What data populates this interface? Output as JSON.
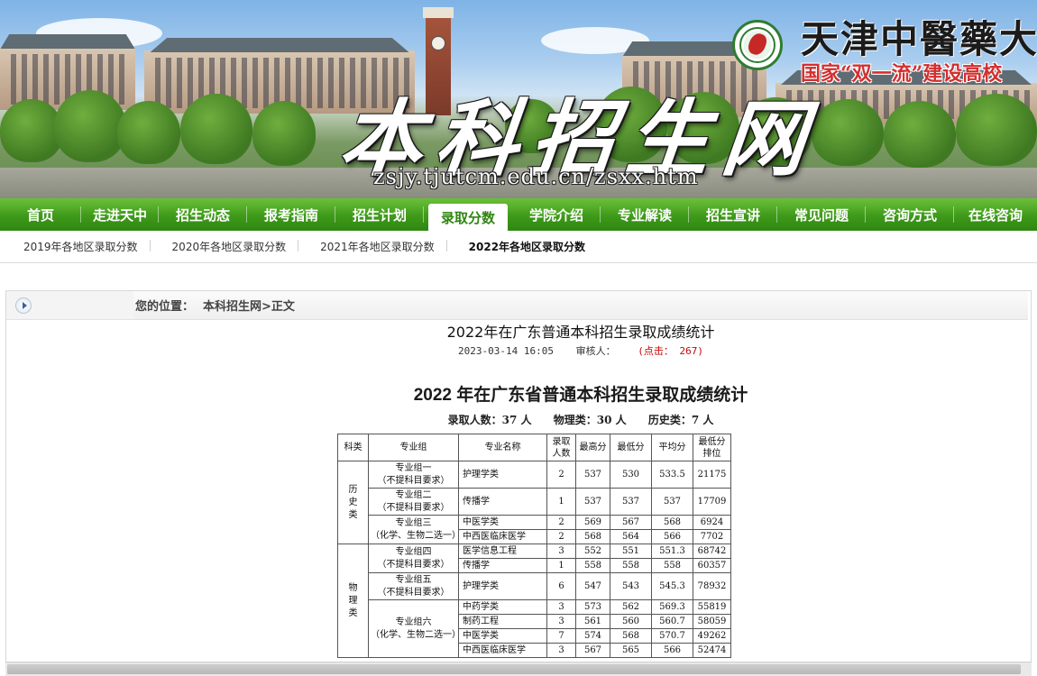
{
  "banner": {
    "site_title": "本科招生网",
    "url": "zsjy.tjutcm.edu.cn/zsxx.htm",
    "university_name": "天津中醫藥大學",
    "slogan": "国家“双一流”建设高校"
  },
  "main_nav": {
    "items": [
      {
        "label": "首页"
      },
      {
        "label": "走进天中"
      },
      {
        "label": "招生动态"
      },
      {
        "label": "报考指南"
      },
      {
        "label": "招生计划"
      },
      {
        "label": "录取分数",
        "active": true
      },
      {
        "label": "学院介绍"
      },
      {
        "label": "专业解读"
      },
      {
        "label": "招生宣讲"
      },
      {
        "label": "常见问题"
      },
      {
        "label": "咨询方式"
      },
      {
        "label": "在线咨询"
      }
    ]
  },
  "sub_nav": {
    "items": [
      {
        "label": "2019年各地区录取分数"
      },
      {
        "label": "2020年各地区录取分数"
      },
      {
        "label": "2021年各地区录取分数"
      },
      {
        "label": "2022年各地区录取分数",
        "current": true
      }
    ]
  },
  "location": {
    "label": "您的位置：",
    "crumbs": "本科招生网>正文"
  },
  "article": {
    "title": "2022年在广东普通本科招生录取成绩统计",
    "date": "2023-03-14 16:05",
    "reviewer": "审核人：",
    "hits": "(点击： 267)"
  },
  "document": {
    "title": "2022 年在广东省普通本科招生录取成绩统计",
    "total": "录取人数：37 人",
    "physics": "物理类：30 人",
    "history": "历史类：7 人",
    "table": {
      "headers": [
        "科类",
        "专业组",
        "专业名称",
        "录取人数",
        "最高分",
        "最低分",
        "平均分",
        "最低分排位"
      ],
      "header_lines": {
        "admitted": [
          "录取",
          "人数"
        ],
        "min_rank": [
          "最低分",
          "排位"
        ]
      },
      "categories": [
        {
          "name": "历史类",
          "chars": [
            "历",
            "史",
            "类"
          ]
        },
        {
          "name": "物理类",
          "chars": [
            "物",
            "理",
            "类"
          ]
        }
      ],
      "groups": [
        {
          "line1": "专业组一",
          "line2": "（不提科目要求）"
        },
        {
          "line1": "专业组二",
          "line2": "（不提科目要求）"
        },
        {
          "line1": "专业组三",
          "line2": "（化学、生物二选一）"
        },
        {
          "line1": "专业组四",
          "line2": "（不提科目要求）"
        },
        {
          "line1": "专业组五",
          "line2": "（不提科目要求）"
        },
        {
          "line1": "专业组六",
          "line2": "（化学、生物二选一）"
        }
      ],
      "rows": [
        {
          "major": "护理学类",
          "count": "2",
          "max": "537",
          "min": "530",
          "avg": "533.5",
          "rank": "21175"
        },
        {
          "major": "传播学",
          "count": "1",
          "max": "537",
          "min": "537",
          "avg": "537",
          "rank": "17709"
        },
        {
          "major": "中医学类",
          "count": "2",
          "max": "569",
          "min": "567",
          "avg": "568",
          "rank": "6924"
        },
        {
          "major": "中西医临床医学",
          "count": "2",
          "max": "568",
          "min": "564",
          "avg": "566",
          "rank": "7702"
        },
        {
          "major": "医学信息工程",
          "count": "3",
          "max": "552",
          "min": "551",
          "avg": "551.3",
          "rank": "68742"
        },
        {
          "major": "传播学",
          "count": "1",
          "max": "558",
          "min": "558",
          "avg": "558",
          "rank": "60357"
        },
        {
          "major": "护理学类",
          "count": "6",
          "max": "547",
          "min": "543",
          "avg": "545.3",
          "rank": "78932"
        },
        {
          "major": "中药学类",
          "count": "3",
          "max": "573",
          "min": "562",
          "avg": "569.3",
          "rank": "55819"
        },
        {
          "major": "制药工程",
          "count": "3",
          "max": "561",
          "min": "560",
          "avg": "560.7",
          "rank": "58059"
        },
        {
          "major": "中医学类",
          "count": "7",
          "max": "574",
          "min": "568",
          "avg": "570.7",
          "rank": "49262"
        },
        {
          "major": "中西医临床医学",
          "count": "3",
          "max": "567",
          "min": "565",
          "avg": "566",
          "rank": "52474"
        }
      ]
    }
  }
}
